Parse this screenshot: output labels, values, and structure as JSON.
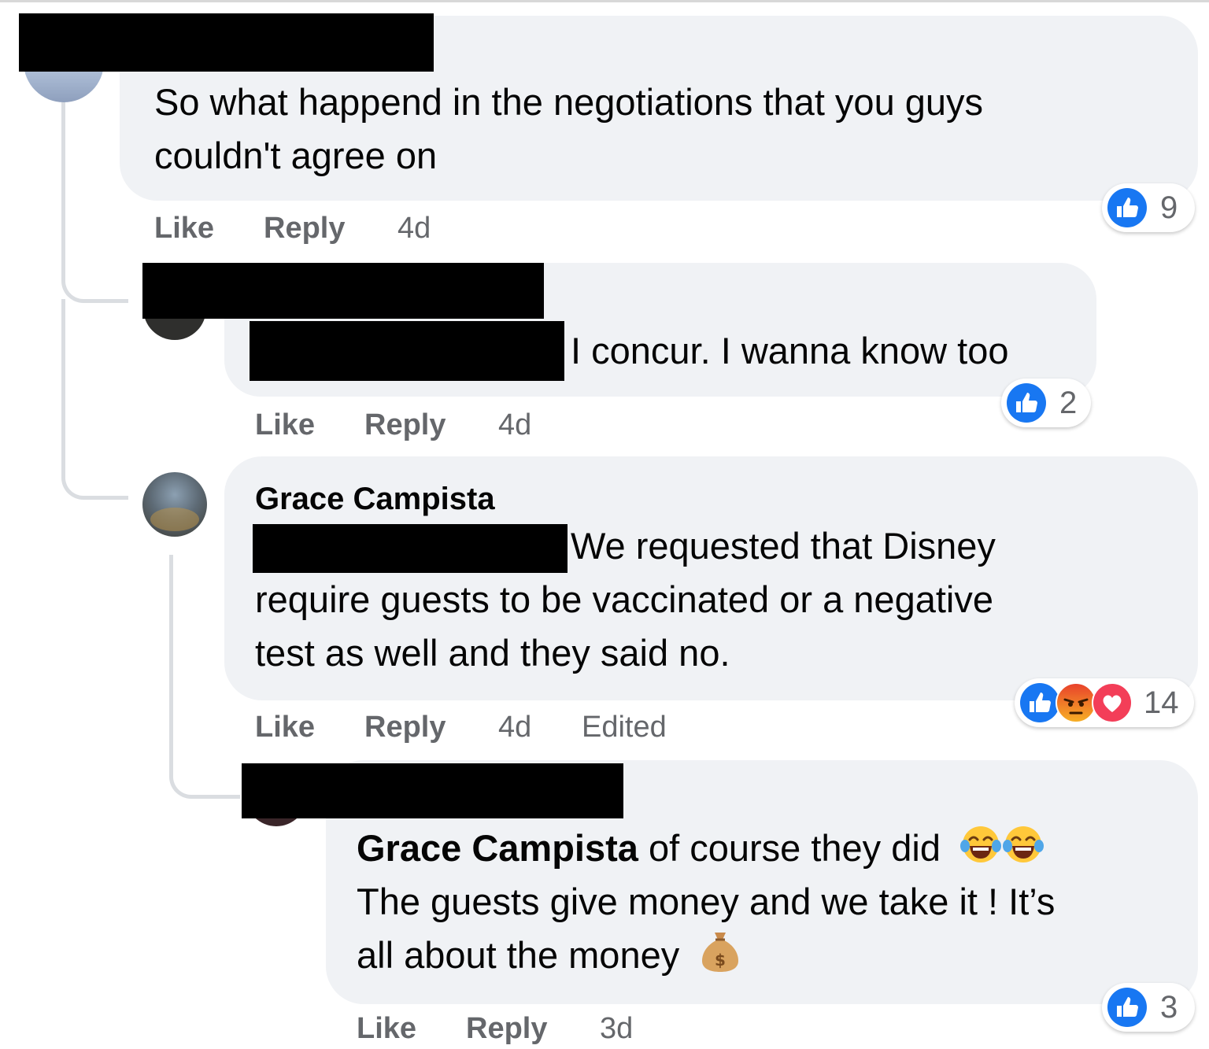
{
  "colors": {
    "bubble": "#f0f2f5",
    "like_blue": "#1877f2",
    "meta_text": "#65676b",
    "angry": "#f2682d",
    "love": "#f33e58"
  },
  "comments": [
    {
      "text": "So what happend in the negotiations that you guys couldn't agree on",
      "lines": [
        "So what happend in the negotiations that you guys",
        "couldn't agree on"
      ],
      "actions": {
        "like": "Like",
        "reply": "Reply",
        "time": "4d"
      },
      "reactions": {
        "icons": [
          "like-icon"
        ],
        "count": "9"
      }
    },
    {
      "text": "I concur. I wanna know too",
      "actions": {
        "like": "Like",
        "reply": "Reply",
        "time": "4d"
      },
      "reactions": {
        "icons": [
          "like-icon"
        ],
        "count": "2"
      }
    },
    {
      "author": "Grace Campista",
      "text": "We requested that Disney require guests to be vaccinated or a negative test as well and they said no.",
      "lines": [
        "We requested that Disney",
        "require guests to be vaccinated or a negative",
        "test as well and they said no."
      ],
      "actions": {
        "like": "Like",
        "reply": "Reply",
        "time": "4d",
        "edited": "Edited"
      },
      "reactions": {
        "icons": [
          "like-icon",
          "angry-icon",
          "love-icon"
        ],
        "count": "14"
      }
    },
    {
      "mention": "Grace Campista",
      "text": "of course they did 😂😂 The guests give money and we take it ! It’s all about the money 💰",
      "lines": [
        " of course they did",
        "The guests give money and we take it ! It’s",
        "all about the money"
      ],
      "emojis": [
        "tears-of-joy-emoji",
        "tears-of-joy-emoji",
        "money-bag-emoji"
      ],
      "actions": {
        "like": "Like",
        "reply": "Reply",
        "time": "3d"
      },
      "reactions": {
        "icons": [
          "like-icon"
        ],
        "count": "3"
      }
    }
  ]
}
